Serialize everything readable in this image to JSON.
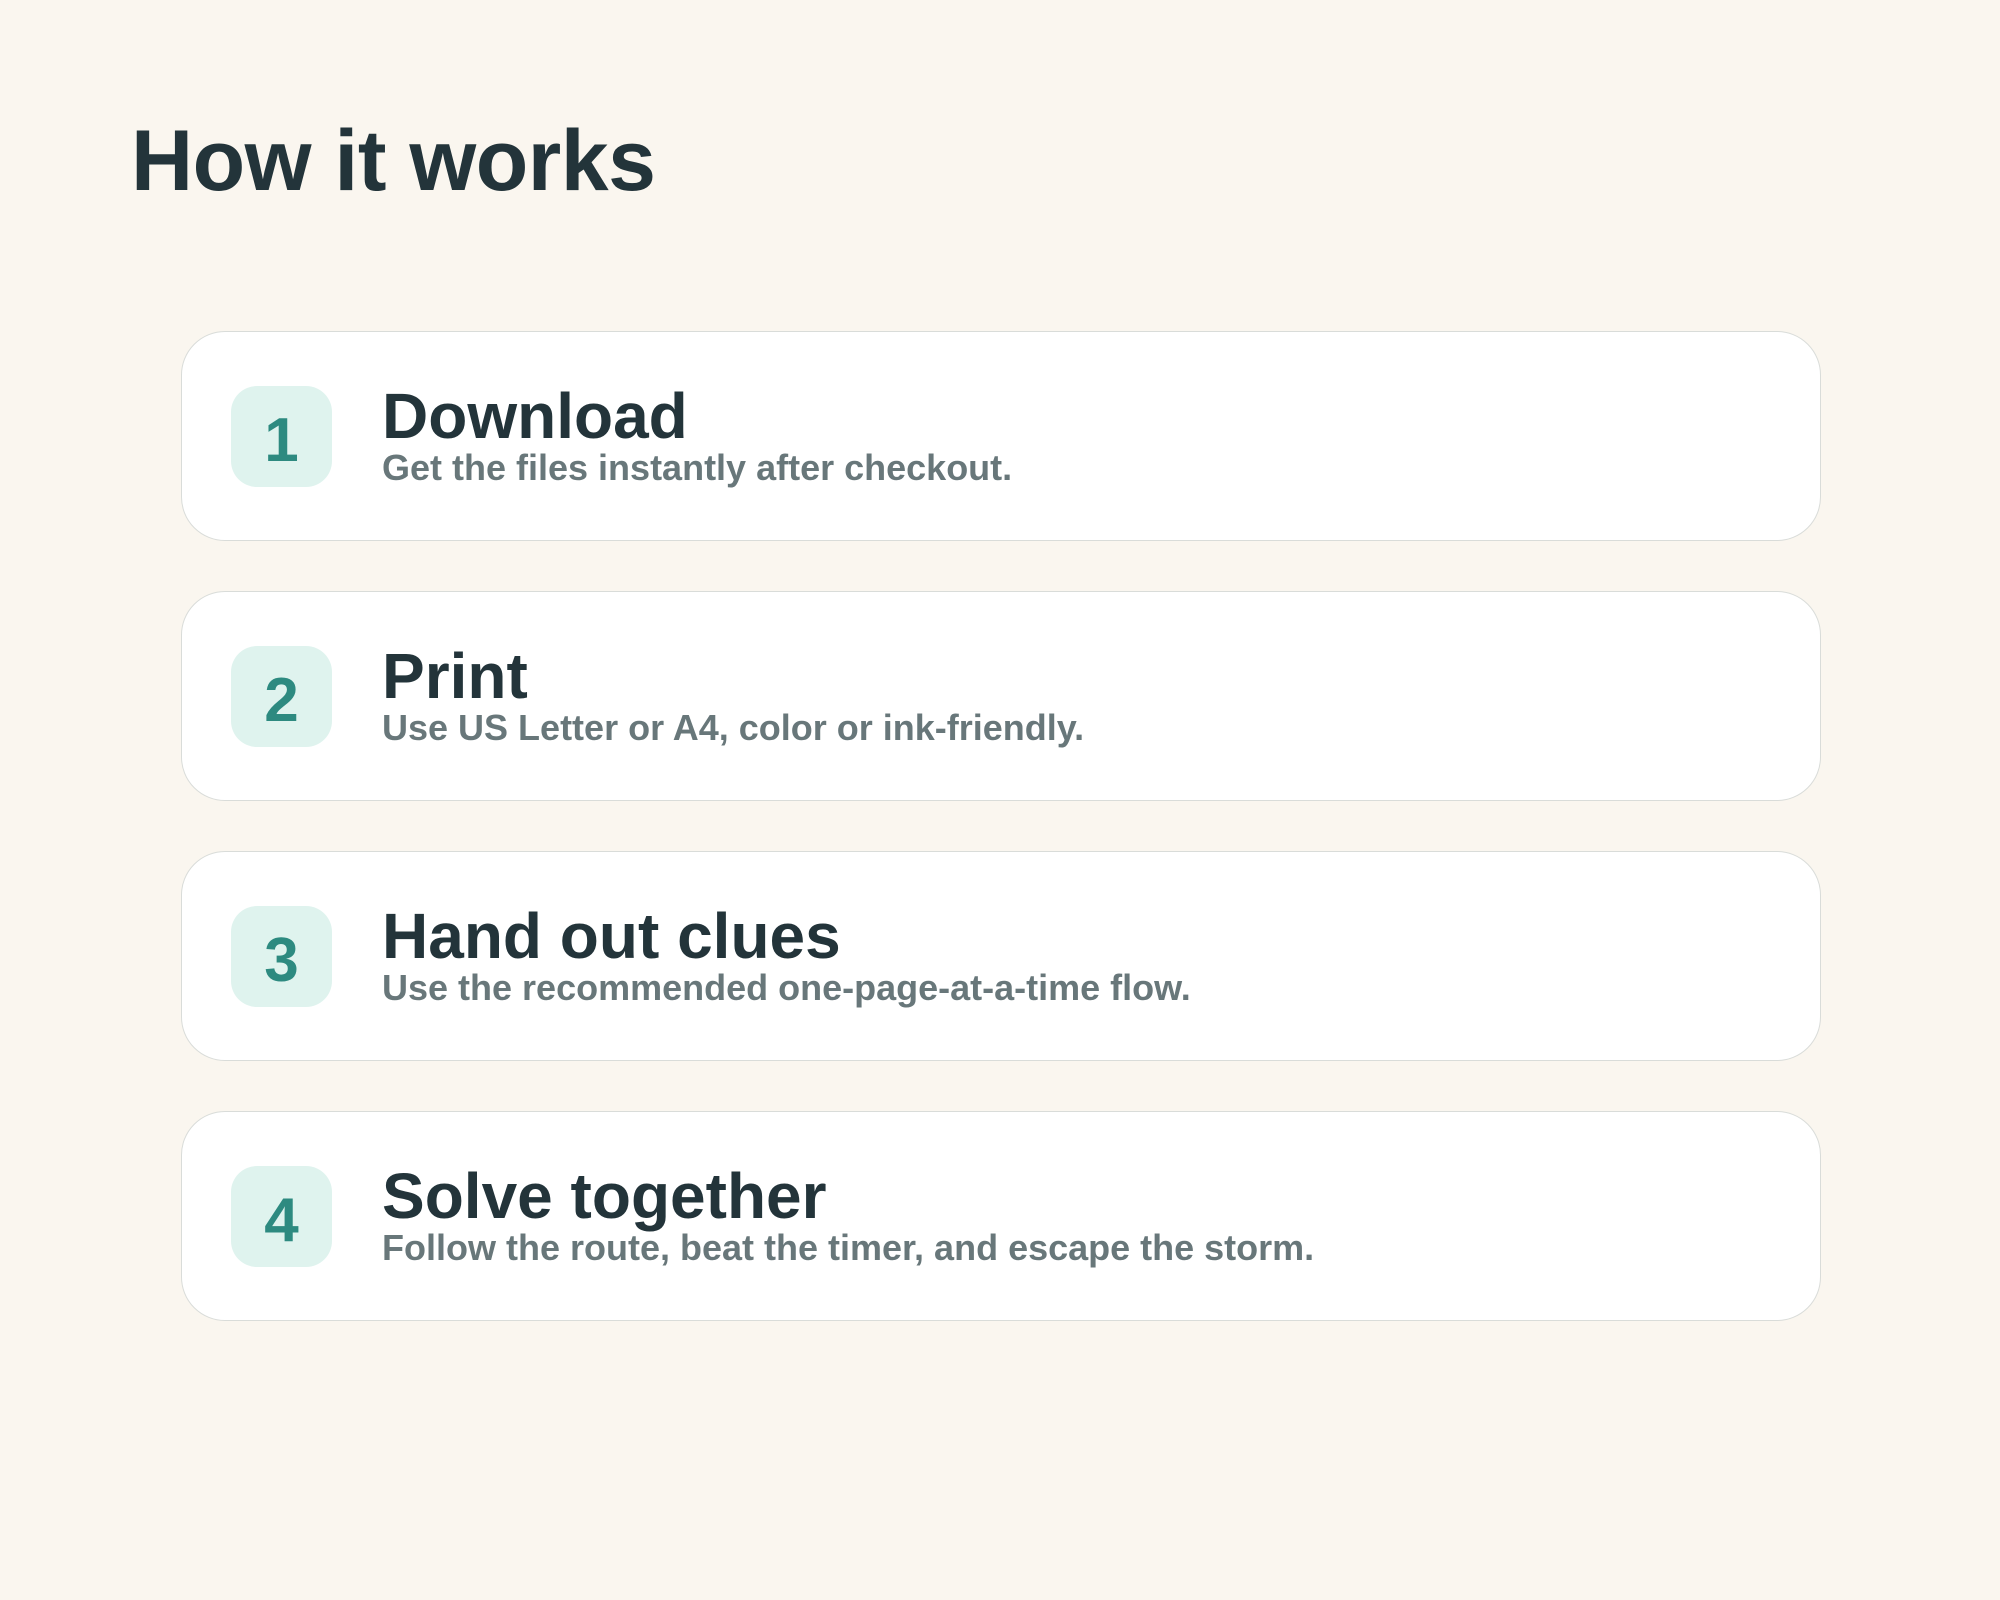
{
  "page": {
    "title": "How it works"
  },
  "steps": [
    {
      "number": "1",
      "title": "Download",
      "description": "Get the files instantly after checkout."
    },
    {
      "number": "2",
      "title": "Print",
      "description": "Use US Letter or A4, color or ink-friendly."
    },
    {
      "number": "3",
      "title": "Hand out clues",
      "description": "Use the recommended one-page-at-a-time flow."
    },
    {
      "number": "4",
      "title": "Solve together",
      "description": "Follow the route, beat the timer, and escape the storm."
    }
  ],
  "colors": {
    "background": "#faf6ef",
    "card": "#ffffff",
    "badge": "#dff3ee",
    "accent": "#2d8a80",
    "heading": "#23343a",
    "muted": "#68777a"
  }
}
